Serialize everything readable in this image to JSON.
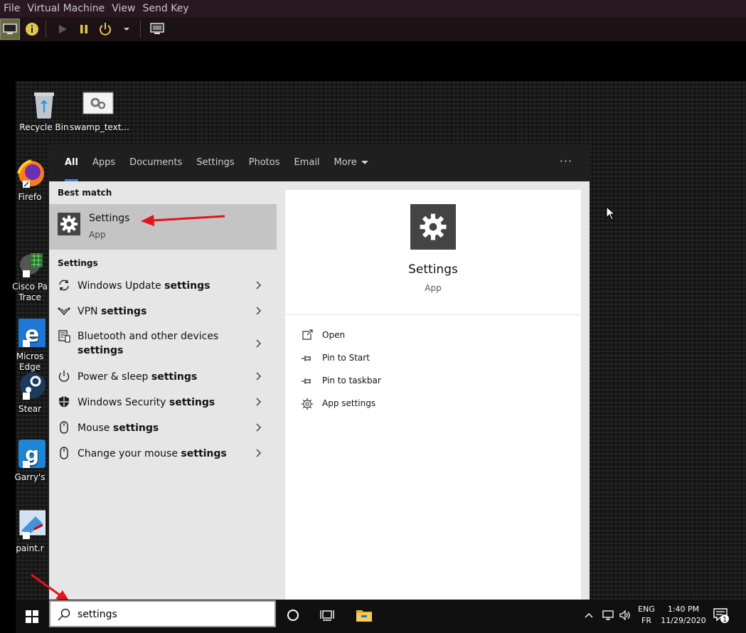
{
  "host": {
    "menu": [
      "File",
      "Virtual Machine",
      "View",
      "Send Key"
    ]
  },
  "desktop_icons": [
    {
      "name": "recycle-bin",
      "label": "Recycle Bin"
    },
    {
      "name": "swamp-text",
      "label": "swamp_text..."
    },
    {
      "name": "firefox",
      "label": "Firefo"
    },
    {
      "name": "cisco-packet-tracer",
      "label": "Cisco Pa\nTrace"
    },
    {
      "name": "microsoft-edge",
      "label": "Micros\nEdge"
    },
    {
      "name": "steam",
      "label": "Stear"
    },
    {
      "name": "garrys-mod",
      "label": "Garry's"
    },
    {
      "name": "paint",
      "label": "paint.r"
    }
  ],
  "search": {
    "tabs": [
      "All",
      "Apps",
      "Documents",
      "Settings",
      "Photos",
      "Email",
      "More"
    ],
    "more_dots": "···",
    "best_match_header": "Best match",
    "best_match": {
      "title": "Settings",
      "subtitle": "App"
    },
    "settings_header": "Settings",
    "results": [
      {
        "pre": "Windows Update ",
        "bold": "settings",
        "icon": "sync-icon"
      },
      {
        "pre": "VPN ",
        "bold": "settings",
        "icon": "vpn-icon"
      },
      {
        "pre": "Bluetooth and other devices",
        "bold": "settings",
        "icon": "devices-icon",
        "multiline": true
      },
      {
        "pre": "Power & sleep ",
        "bold": "settings",
        "icon": "power-icon"
      },
      {
        "pre": "Windows Security ",
        "bold": "settings",
        "icon": "shield-icon"
      },
      {
        "pre": "Mouse ",
        "bold": "settings",
        "icon": "mouse-icon"
      },
      {
        "pre": "Change your mouse ",
        "bold": "settings",
        "icon": "mouse-icon"
      }
    ],
    "preview": {
      "title": "Settings",
      "subtitle": "App"
    },
    "actions": [
      {
        "label": "Open",
        "icon": "open-icon"
      },
      {
        "label": "Pin to Start",
        "icon": "pin-icon"
      },
      {
        "label": "Pin to taskbar",
        "icon": "pin-icon"
      },
      {
        "label": "App settings",
        "icon": "gear-icon"
      }
    ]
  },
  "taskbar": {
    "search_value": "settings",
    "lang_top": "ENG",
    "lang_bottom": "FR",
    "time": "1:40 PM",
    "date": "11/29/2020",
    "notification_count": "1"
  }
}
